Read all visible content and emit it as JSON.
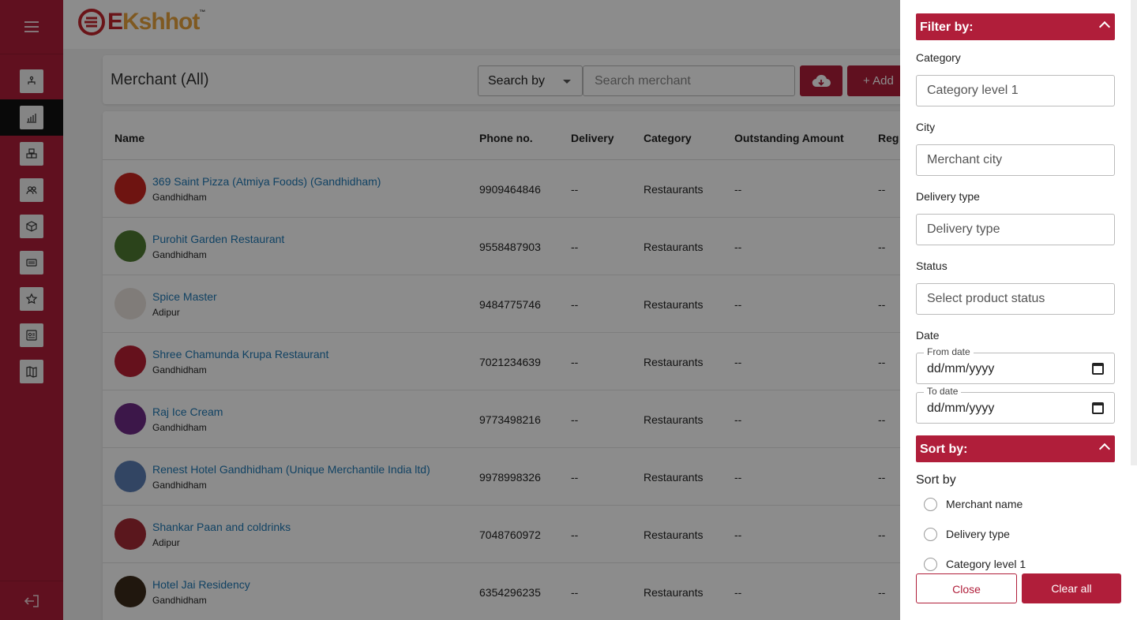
{
  "app": {
    "logo_text_e": "E",
    "logo_text_rest": "Kshhot",
    "logo_tm": "™"
  },
  "colors": {
    "brand": "#b01e3a",
    "link": "#1f79b5",
    "logo_orange": "#e8a33c"
  },
  "sidebar": {
    "items": [
      {
        "icon": "sitemap-icon"
      },
      {
        "icon": "chart-icon",
        "active": true
      },
      {
        "icon": "cubes-icon"
      },
      {
        "icon": "users-icon"
      },
      {
        "icon": "box-icon"
      },
      {
        "icon": "ticket-icon"
      },
      {
        "icon": "star-icon"
      },
      {
        "icon": "id-card-icon"
      },
      {
        "icon": "map-icon"
      }
    ],
    "bottom_icon": "logout-icon"
  },
  "page": {
    "title": "Merchant (All)",
    "search_by_label": "Search by",
    "search_placeholder": "Search merchant",
    "add_label": "+ Add"
  },
  "table": {
    "headers": {
      "name": "Name",
      "phone": "Phone no.",
      "delivery": "Delivery",
      "category": "Category",
      "outstanding": "Outstanding Amount",
      "reg": "Reg"
    },
    "rows": [
      {
        "name": "369 Saint Pizza (Atmiya Foods) (Gandhidham)",
        "city": "Gandhidham",
        "phone": "9909464846",
        "delivery": "--",
        "category": "Restaurants",
        "outstanding": "--",
        "reg": "--",
        "avatar_color": "#c9251f"
      },
      {
        "name": "Purohit Garden Restaurant",
        "city": "Gandhidham",
        "phone": "9558487903",
        "delivery": "--",
        "category": "Restaurants",
        "outstanding": "--",
        "reg": "--",
        "avatar_color": "#4f7a32"
      },
      {
        "name": "Spice Master",
        "city": "Adipur",
        "phone": "9484775746",
        "delivery": "--",
        "category": "Restaurants",
        "outstanding": "--",
        "reg": "--",
        "avatar_color": "#e9e2dc"
      },
      {
        "name": "Shree Chamunda Krupa Restaurant",
        "city": "Gandhidham",
        "phone": "7021234639",
        "delivery": "--",
        "category": "Restaurants",
        "outstanding": "--",
        "reg": "--",
        "avatar_color": "#b81f33"
      },
      {
        "name": "Raj Ice Cream",
        "city": "Gandhidham",
        "phone": "9773498216",
        "delivery": "--",
        "category": "Restaurants",
        "outstanding": "--",
        "reg": "--",
        "avatar_color": "#6d2a86"
      },
      {
        "name": "Renest Hotel Gandhidham (Unique Merchantile India ltd)",
        "city": "Gandhidham",
        "phone": "9978998326",
        "delivery": "--",
        "category": "Restaurants",
        "outstanding": "--",
        "reg": "--",
        "avatar_color": "#5b7fb4"
      },
      {
        "name": "Shankar Paan and coldrinks",
        "city": "Adipur",
        "phone": "7048760972",
        "delivery": "--",
        "category": "Restaurants",
        "outstanding": "--",
        "reg": "--",
        "avatar_color": "#a52a35"
      },
      {
        "name": "Hotel Jai Residency",
        "city": "Gandhidham",
        "phone": "6354296235",
        "delivery": "--",
        "category": "Restaurants",
        "outstanding": "--",
        "reg": "--",
        "avatar_color": "#3b2a1a"
      }
    ]
  },
  "filter": {
    "filter_by_title": "Filter by:",
    "category_label": "Category",
    "category_placeholder": "Category level 1",
    "city_label": "City",
    "city_placeholder": "Merchant city",
    "delivery_label": "Delivery type",
    "delivery_placeholder": "Delivery type",
    "status_label": "Status",
    "status_placeholder": "Select product status",
    "date_label": "Date",
    "from_date_label": "From date",
    "from_date_value": "dd/mm/yyyy",
    "to_date_label": "To date",
    "to_date_value": "dd/mm/yyyy",
    "sort_by_title": "Sort by:",
    "sort_by_label": "Sort by",
    "sort_options": [
      "Merchant name",
      "Delivery type",
      "Category level 1"
    ],
    "close_label": "Close",
    "clear_label": "Clear all"
  }
}
